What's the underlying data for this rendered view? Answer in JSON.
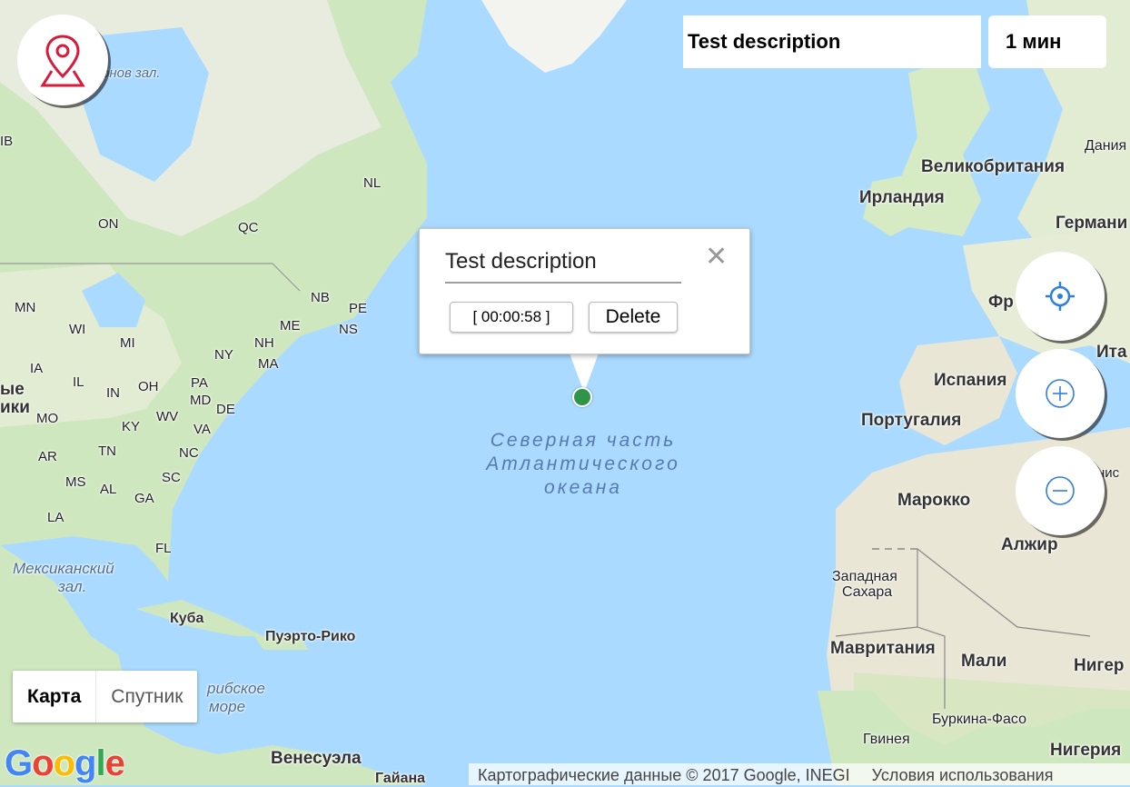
{
  "map": {
    "ocean_label": [
      "Северная часть",
      "Атлантического",
      "океана"
    ],
    "water_labels": [
      "онов зал.",
      "Мексиканский",
      "зал.",
      "рибское",
      "море"
    ],
    "country_labels": [
      "Великобритания",
      "Ирландия",
      "Германи",
      "Фр",
      "Ита",
      "Испания",
      "Португалия",
      "Марокко",
      "Алжир",
      "Западная",
      "Сахара",
      "Мавритания",
      "Мали",
      "Нигер",
      "Буркина-Фасо",
      "Гвинея",
      "Нигерия",
      "Дания",
      "Куба",
      "Пуэрто-Рико",
      "Венесуэла",
      "Гайана",
      "ые",
      "ики",
      "нис"
    ],
    "region_labels": [
      "NL",
      "QC",
      "ON",
      "NB",
      "PE",
      "NS",
      "ME",
      "NH",
      "MA",
      "NY",
      "PA",
      "MD",
      "DE",
      "MN",
      "WI",
      "MI",
      "IA",
      "IL",
      "IN",
      "OH",
      "MO",
      "KY",
      "WV",
      "VA",
      "AR",
      "TN",
      "NC",
      "MS",
      "AL",
      "GA",
      "SC",
      "LA",
      "FL",
      "IB"
    ]
  },
  "header": {
    "description": "Test description",
    "timer": "1 мин"
  },
  "popup": {
    "description_value": "Test description",
    "close_glyph": "✕",
    "timer_label": "[ 00:00:58 ]",
    "delete_label": "Delete"
  },
  "map_type": {
    "map_label": "Карта",
    "satellite_label": "Спутник"
  },
  "footer": {
    "google_logo": "Google",
    "attribution": "Картографические данные © 2017 Google, INEGI",
    "terms": "Условия использования"
  },
  "icons": {
    "app_logo": "map-pin-icon",
    "locate": "crosshair-icon",
    "zoom_in": "plus-circle-icon",
    "zoom_out": "minus-circle-icon"
  },
  "colors": {
    "water": "#aadaff",
    "land": "#eae6d6",
    "forest": "#cfe7bf",
    "marker": "#2e9447",
    "logo_red": "#d81b3c",
    "control_blue": "#2f7fe0"
  }
}
